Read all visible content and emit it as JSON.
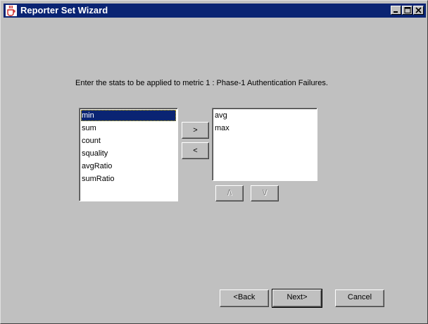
{
  "window": {
    "title": "Reporter Set Wizard"
  },
  "instruction": "Enter the stats to be applied to metric 1 : Phase-1 Authentication Failures.",
  "available_stats": [
    "min",
    "sum",
    "count",
    "squality",
    "avgRatio",
    "sumRatio"
  ],
  "selected_available_index": 0,
  "applied_stats": [
    "avg",
    "max"
  ],
  "transfer_buttons": {
    "add": ">",
    "remove": "<"
  },
  "order_buttons": {
    "up": "/\\",
    "down": "\\/"
  },
  "nav_buttons": {
    "back": "<Back",
    "next": "Next>",
    "cancel": "Cancel"
  },
  "colors": {
    "background": "#c0c0c0",
    "titlebar": "#0a2473",
    "selection": "#0a2473"
  }
}
